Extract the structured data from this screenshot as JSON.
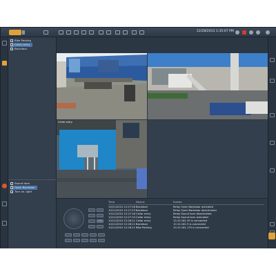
{
  "toolbar": {
    "datetime": "12/28/2013 1:35:07 PM",
    "accent_color": "#e0a238"
  },
  "tree": {
    "items": [
      {
        "label": "Bike Parking",
        "selected": false
      },
      {
        "label": "Cellar entry",
        "selected": true
      },
      {
        "label": "Backdoor",
        "selected": false
      }
    ]
  },
  "actions": {
    "items": [
      {
        "label": "Sound horn",
        "selected": false
      },
      {
        "label": "Open Backdoor",
        "selected": true
      },
      {
        "label": "Turn on Light",
        "selected": false
      }
    ]
  },
  "video": {
    "tile3_label": "Cellar entry"
  },
  "events": {
    "headers": {
      "time": "Time",
      "device": "Device",
      "events": "Events"
    },
    "rows": [
      {
        "time": "10/11/2010 12:27:26",
        "device": "Backdoor",
        "event": "Relay Open Backdoor activated"
      },
      {
        "time": "10/11/2010 12:27:23",
        "device": "Backdoor",
        "event": "Relay Open Backdoor deactivated"
      },
      {
        "time": "10/11/2010 12:27:18",
        "device": "Cellar entry",
        "event": "Relay Sound horn deactivated"
      },
      {
        "time": "10/11/2010 12:27:15",
        "device": "Cellar entry",
        "event": "Relay Sound horn activated"
      },
      {
        "time": "10/11/2010 12:26:11",
        "device": "Cellar entry",
        "event": "10.10.181.29 is connected"
      },
      {
        "time": "10/11/2010 12:26:11",
        "device": "Backdoor",
        "event": "10.10.181.5 is connected"
      },
      {
        "time": "10/11/2010 12:26:11",
        "device": "Bike Parking",
        "event": "10.10.181.170 is connected"
      }
    ]
  },
  "ptz": {
    "auto_label": "Auto"
  }
}
